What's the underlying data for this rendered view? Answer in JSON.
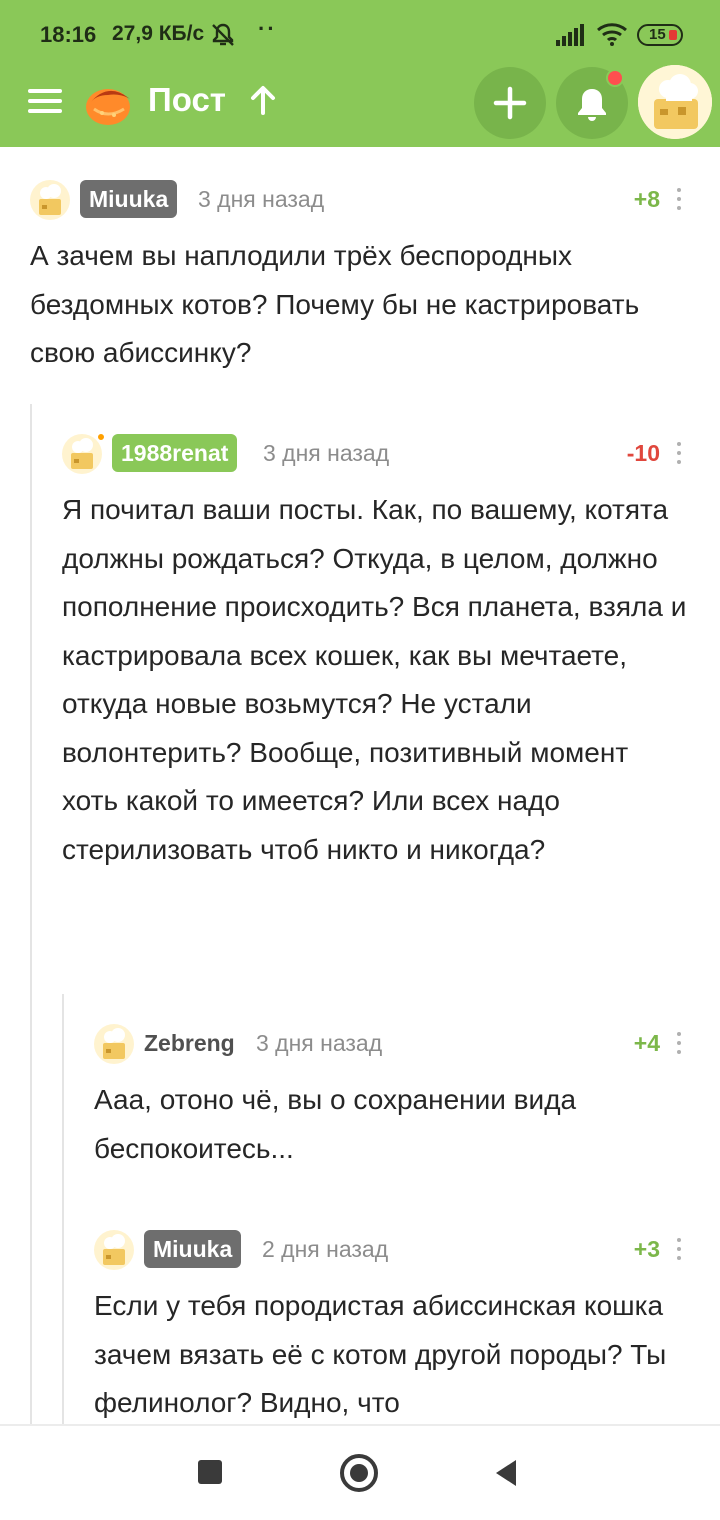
{
  "status_bar": {
    "time": "18:16",
    "speed": "27,9 КБ/с",
    "dots": "··",
    "battery": "15"
  },
  "app_bar": {
    "title": "Пост",
    "icons": [
      "menu-icon",
      "logo-icon",
      "arrow-up-icon",
      "plus-icon",
      "bell-icon",
      "avatar"
    ]
  },
  "colors": {
    "accent": "#8ac858",
    "badge_gray": "#6e6e6e",
    "badge_green": "#8ac858",
    "positive": "#7cb74a",
    "negative": "#e0473d",
    "notification": "#ff4f4f"
  },
  "comments": [
    {
      "user": "Miuuka",
      "time": "3 дня назад",
      "rating": "+8",
      "text": "А зачем вы наплодили трёх беспородных бездомных котов? Почему бы не кастрировать свою абиссинку?"
    },
    {
      "user": "1988renat",
      "time": "3 дня назад",
      "rating": "-10",
      "text": "Я почитал ваши посты. Как, по вашему, котята должны рождаться? Откуда, в целом, должно пополнение происходить? Вся планета, взяла и кастрировала всех кошек, как вы мечтаете, откуда новые возьмутся? Не устали волонтерить? Вообще, позитивный момент хоть какой то имеется? Или всех надо стерилизовать чтоб никто и никогда?"
    },
    {
      "user": "Zebreng",
      "time": "3 дня назад",
      "rating": "+4",
      "text": "Ааа, отоно чё, вы о сохранении вида беспокоитесь..."
    },
    {
      "user": "Miuuka",
      "time": "2 дня назад",
      "rating": "+3",
      "text": "Если у тебя породистая абиссинская кошка зачем вязать её с котом другой породы? Ты фелинолог? Видно, что"
    }
  ],
  "nav_bar": {
    "icons": [
      "recents-square-icon",
      "home-circle-icon",
      "back-triangle-icon"
    ]
  }
}
